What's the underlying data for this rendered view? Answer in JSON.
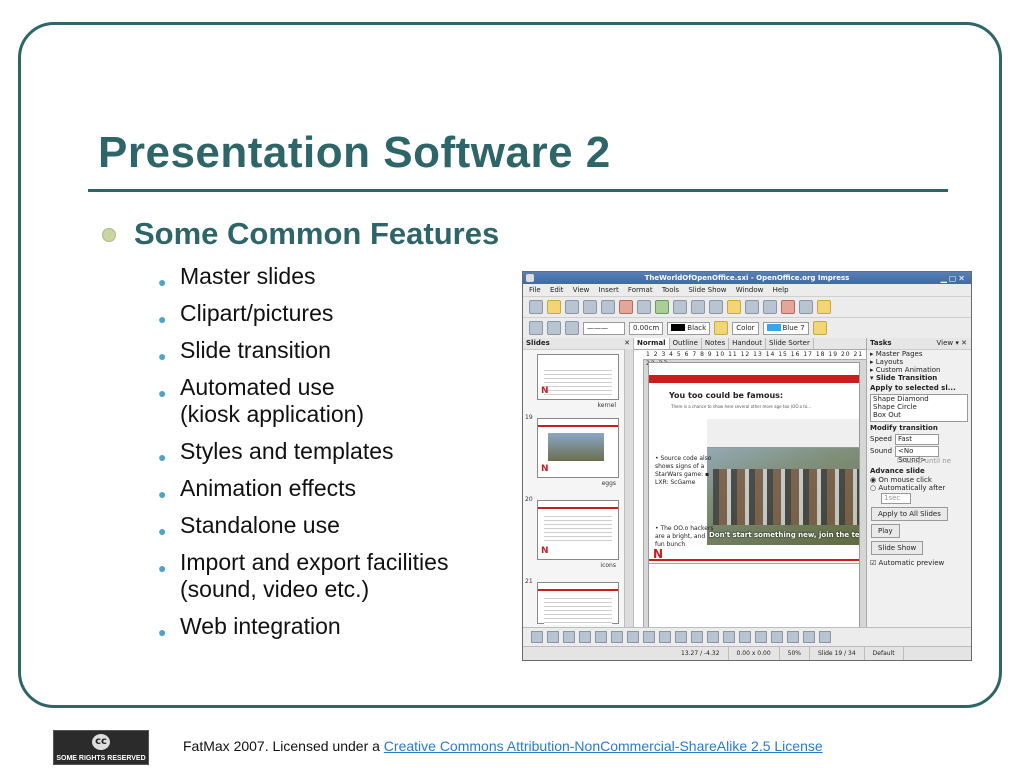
{
  "slide": {
    "title": "Presentation Software 2",
    "heading": "Some Common Features",
    "features": [
      "Master slides",
      "Clipart/pictures",
      "Slide transition",
      "Automated use\n(kiosk application)",
      "Styles and templates",
      "Animation effects",
      "Standalone use",
      "Import and export facilities\n(sound, video etc.)",
      "Web integration"
    ]
  },
  "screenshot": {
    "window_title": "TheWorldOfOpenOffice.sxi - OpenOffice.org Impress",
    "menus": [
      "File",
      "Edit",
      "View",
      "Insert",
      "Format",
      "Tools",
      "Slide Show",
      "Window",
      "Help"
    ],
    "toolbar": {
      "line_width": "0.00cm",
      "line_color": "Black",
      "area_style": "Color",
      "area_color": "Blue 7"
    },
    "slides_pane": {
      "title": "Slides",
      "thumbs": [
        {
          "num": "",
          "label": "kernel"
        },
        {
          "num": "19",
          "label": "eggs"
        },
        {
          "num": "20",
          "label": "icons"
        },
        {
          "num": "21",
          "label": ""
        }
      ]
    },
    "view_tabs": [
      "Normal",
      "Outline",
      "Notes",
      "Handout",
      "Slide Sorter"
    ],
    "ruler_numbers": "1 2 3 4 5 6 7 8 9 10 11 12 13 14 15 16 17 18 19 20 21 22 23",
    "current_slide": {
      "title": "You too could be famous:",
      "subtitle": "There is a chance to show here several other more age too (OO.o to...",
      "bullet1": "• Source code also shows signs of a StarWars game: ▪ LXR: ScGame",
      "bullet2": "• The OO.o hackers are a bright, and fun bunch",
      "caption": "Don't start something new, join the team..."
    },
    "tasks": {
      "title": "Tasks",
      "view_label": "View",
      "items": [
        "Master Pages",
        "Layouts",
        "Custom Animation",
        "Slide Transition"
      ],
      "apply_label": "Apply to selected sl...",
      "transitions": [
        "Shape Diamond",
        "Shape Circle",
        "Box Out"
      ],
      "modify_label": "Modify transition",
      "speed_label": "Speed",
      "speed_value": "Fast",
      "sound_label": "Sound",
      "sound_value": "<No Sound>",
      "loop_label": "Loop until ne",
      "advance_label": "Advance slide",
      "on_click": "On mouse click",
      "auto": "Automatically after",
      "auto_value": "1sec",
      "apply_all": "Apply to All Slides",
      "play": "Play",
      "slideshow": "Slide Show",
      "preview": "Automatic preview"
    },
    "status": {
      "position": "13.27 / -4.32",
      "size": "0.00 x 0.00",
      "zoom": "50%",
      "slide": "Slide 19 / 34",
      "layout": "Default"
    }
  },
  "footer": {
    "cc_badge": "SOME RIGHTS RESERVED",
    "cc_symbol": "cc",
    "prefix": "FatMax 2007. Licensed under a ",
    "link": "Creative Commons Attribution-NonCommercial-ShareAlike 2.5 License"
  }
}
